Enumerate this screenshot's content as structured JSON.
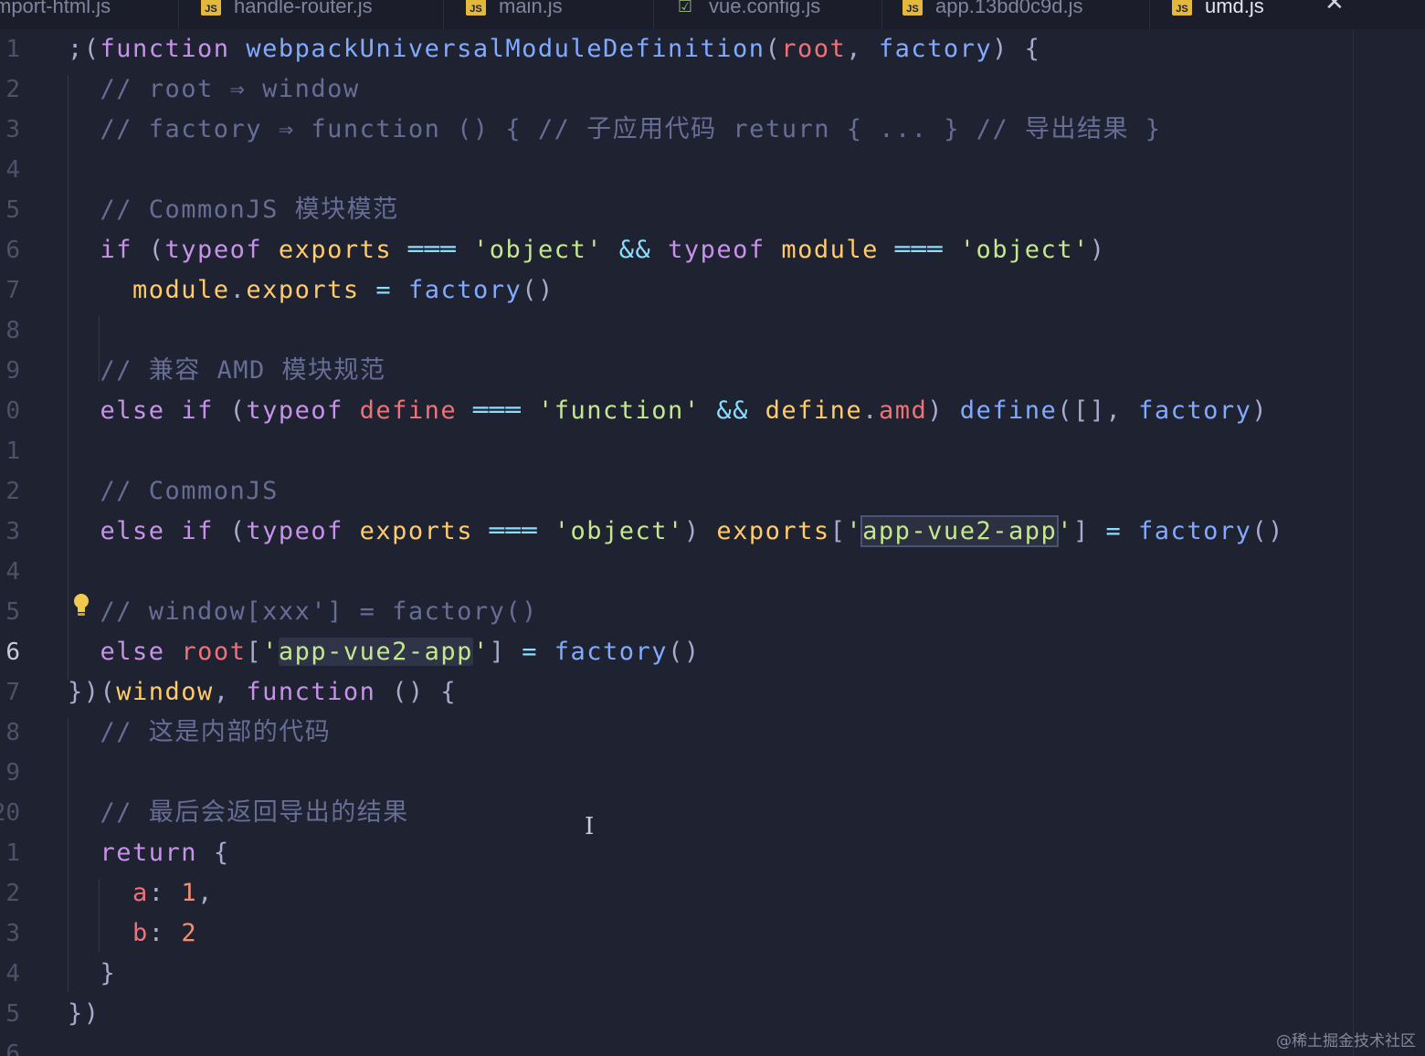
{
  "tabs": [
    {
      "label": "mport-html.js",
      "icon": "none",
      "active": false
    },
    {
      "label": "handle-router.js",
      "icon": "js",
      "active": false
    },
    {
      "label": "main.js",
      "icon": "js",
      "active": false
    },
    {
      "label": "vue.config.js",
      "icon": "config",
      "active": false
    },
    {
      "label": "app.13bd0c9d.js",
      "icon": "js",
      "active": false
    },
    {
      "label": "umd.js",
      "icon": "js",
      "active": true
    }
  ],
  "js_icon_text": "JS",
  "close_glyph": "✕",
  "line_numbers": [
    "1",
    "2",
    "3",
    "4",
    "5",
    "6",
    "7",
    "8",
    "9",
    "0",
    "1",
    "2",
    "3",
    "4",
    "5",
    "6",
    "7",
    "8",
    "9",
    "20",
    "1",
    "2",
    "3",
    "4",
    "5",
    "6"
  ],
  "current_line_index": 15,
  "code_lines": [
    [
      {
        "t": ";(",
        "c": "punc"
      },
      {
        "t": "function",
        "c": "kw"
      },
      {
        "t": " ",
        "c": "punc"
      },
      {
        "t": "webpackUniversalModuleDefinition",
        "c": "fn"
      },
      {
        "t": "(",
        "c": "punc"
      },
      {
        "t": "root",
        "c": "param"
      },
      {
        "t": ", ",
        "c": "punc"
      },
      {
        "t": "factory",
        "c": "fn"
      },
      {
        "t": ") {",
        "c": "punc"
      }
    ],
    [
      {
        "t": "  // root ⇒ window",
        "c": "cm"
      }
    ],
    [
      {
        "t": "  // factory ⇒ function () { // 子应用代码 return { ... } // 导出结果 }",
        "c": "cm"
      }
    ],
    [],
    [
      {
        "t": "  // CommonJS 模块模范",
        "c": "cm"
      }
    ],
    [
      {
        "t": "  ",
        "c": "punc"
      },
      {
        "t": "if",
        "c": "kw"
      },
      {
        "t": " (",
        "c": "punc"
      },
      {
        "t": "typeof",
        "c": "kw"
      },
      {
        "t": " ",
        "c": "punc"
      },
      {
        "t": "exports",
        "c": "prop"
      },
      {
        "t": " ",
        "c": "punc"
      },
      {
        "t": "═══",
        "c": "op"
      },
      {
        "t": " ",
        "c": "punc"
      },
      {
        "t": "'object'",
        "c": "str"
      },
      {
        "t": " ",
        "c": "punc"
      },
      {
        "t": "&&",
        "c": "op"
      },
      {
        "t": " ",
        "c": "punc"
      },
      {
        "t": "typeof",
        "c": "kw"
      },
      {
        "t": " ",
        "c": "punc"
      },
      {
        "t": "module",
        "c": "prop"
      },
      {
        "t": " ",
        "c": "punc"
      },
      {
        "t": "═══",
        "c": "op"
      },
      {
        "t": " ",
        "c": "punc"
      },
      {
        "t": "'object'",
        "c": "str"
      },
      {
        "t": ")",
        "c": "punc"
      }
    ],
    [
      {
        "t": "    ",
        "c": "punc"
      },
      {
        "t": "module",
        "c": "prop"
      },
      {
        "t": ".",
        "c": "punc"
      },
      {
        "t": "exports",
        "c": "prop"
      },
      {
        "t": " ",
        "c": "punc"
      },
      {
        "t": "=",
        "c": "op"
      },
      {
        "t": " ",
        "c": "punc"
      },
      {
        "t": "factory",
        "c": "fn"
      },
      {
        "t": "()",
        "c": "punc"
      }
    ],
    [],
    [
      {
        "t": "  // 兼容 AMD 模块规范",
        "c": "cm"
      }
    ],
    [
      {
        "t": "  ",
        "c": "punc"
      },
      {
        "t": "else",
        "c": "kw"
      },
      {
        "t": " ",
        "c": "punc"
      },
      {
        "t": "if",
        "c": "kw"
      },
      {
        "t": " (",
        "c": "punc"
      },
      {
        "t": "typeof",
        "c": "kw"
      },
      {
        "t": " ",
        "c": "punc"
      },
      {
        "t": "define",
        "c": "param"
      },
      {
        "t": " ",
        "c": "punc"
      },
      {
        "t": "═══",
        "c": "op"
      },
      {
        "t": " ",
        "c": "punc"
      },
      {
        "t": "'function'",
        "c": "str"
      },
      {
        "t": " ",
        "c": "punc"
      },
      {
        "t": "&&",
        "c": "op"
      },
      {
        "t": " ",
        "c": "punc"
      },
      {
        "t": "define",
        "c": "prop"
      },
      {
        "t": ".",
        "c": "punc"
      },
      {
        "t": "amd",
        "c": "param"
      },
      {
        "t": ") ",
        "c": "punc"
      },
      {
        "t": "define",
        "c": "fn"
      },
      {
        "t": "([], ",
        "c": "punc"
      },
      {
        "t": "factory",
        "c": "fn"
      },
      {
        "t": ")",
        "c": "punc"
      }
    ],
    [],
    [
      {
        "t": "  // CommonJS",
        "c": "cm"
      }
    ],
    [
      {
        "t": "  ",
        "c": "punc"
      },
      {
        "t": "else",
        "c": "kw"
      },
      {
        "t": " ",
        "c": "punc"
      },
      {
        "t": "if",
        "c": "kw"
      },
      {
        "t": " (",
        "c": "punc"
      },
      {
        "t": "typeof",
        "c": "kw"
      },
      {
        "t": " ",
        "c": "punc"
      },
      {
        "t": "exports",
        "c": "prop"
      },
      {
        "t": " ",
        "c": "punc"
      },
      {
        "t": "═══",
        "c": "op"
      },
      {
        "t": " ",
        "c": "punc"
      },
      {
        "t": "'object'",
        "c": "str"
      },
      {
        "t": ") ",
        "c": "punc"
      },
      {
        "t": "exports",
        "c": "prop"
      },
      {
        "t": "[",
        "c": "punc"
      },
      {
        "t": "'",
        "c": "str"
      },
      {
        "t": "app-vue2-app",
        "c": "str",
        "hl": "box"
      },
      {
        "t": "'",
        "c": "str"
      },
      {
        "t": "] ",
        "c": "punc"
      },
      {
        "t": "=",
        "c": "op"
      },
      {
        "t": " ",
        "c": "punc"
      },
      {
        "t": "factory",
        "c": "fn"
      },
      {
        "t": "()",
        "c": "punc"
      }
    ],
    [],
    [
      {
        "t": "  // window[xxx'] = factory()",
        "c": "cm"
      }
    ],
    [
      {
        "t": "  ",
        "c": "punc"
      },
      {
        "t": "else",
        "c": "kw"
      },
      {
        "t": " ",
        "c": "punc"
      },
      {
        "t": "root",
        "c": "param"
      },
      {
        "t": "[",
        "c": "punc"
      },
      {
        "t": "'",
        "c": "str"
      },
      {
        "t": "app-vue2-app",
        "c": "str",
        "hl": "fill"
      },
      {
        "t": "'",
        "c": "str"
      },
      {
        "t": "] ",
        "c": "punc"
      },
      {
        "t": "=",
        "c": "op"
      },
      {
        "t": " ",
        "c": "punc"
      },
      {
        "t": "factory",
        "c": "fn"
      },
      {
        "t": "()",
        "c": "punc"
      }
    ],
    [
      {
        "t": "})(",
        "c": "punc"
      },
      {
        "t": "window",
        "c": "var"
      },
      {
        "t": ", ",
        "c": "punc"
      },
      {
        "t": "function",
        "c": "kw"
      },
      {
        "t": " () {",
        "c": "punc"
      }
    ],
    [
      {
        "t": "  // 这是内部的代码",
        "c": "cm"
      }
    ],
    [],
    [
      {
        "t": "  // 最后会返回导出的结果",
        "c": "cm"
      }
    ],
    [
      {
        "t": "  ",
        "c": "punc"
      },
      {
        "t": "return",
        "c": "kw"
      },
      {
        "t": " {",
        "c": "punc"
      }
    ],
    [
      {
        "t": "    ",
        "c": "punc"
      },
      {
        "t": "a",
        "c": "param"
      },
      {
        "t": ": ",
        "c": "punc"
      },
      {
        "t": "1",
        "c": "num"
      },
      {
        "t": ",",
        "c": "punc"
      }
    ],
    [
      {
        "t": "    ",
        "c": "punc"
      },
      {
        "t": "b",
        "c": "param"
      },
      {
        "t": ": ",
        "c": "punc"
      },
      {
        "t": "2",
        "c": "num"
      }
    ],
    [
      {
        "t": "  }",
        "c": "punc"
      }
    ],
    [
      {
        "t": "})",
        "c": "punc"
      }
    ],
    []
  ],
  "watermark": "@稀土掘金技术社区"
}
